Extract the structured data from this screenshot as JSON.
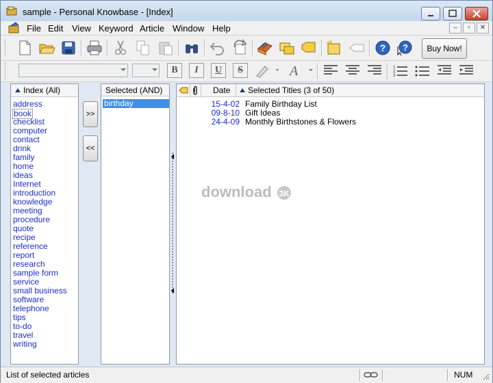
{
  "window": {
    "title": "sample - Personal Knowbase - [Index]"
  },
  "menu": {
    "items": [
      "File",
      "Edit",
      "View",
      "Keyword",
      "Article",
      "Window",
      "Help"
    ]
  },
  "toolbar": {
    "icons": [
      "new-icon",
      "open-icon",
      "save-icon",
      "print-icon",
      "cut-icon",
      "copy-icon",
      "paste-icon",
      "find-icon",
      "undo-icon",
      "redo-icon",
      "keywords-icon",
      "windows-icon",
      "label-icon",
      "new-article-icon",
      "tag-icon",
      "help-icon",
      "whats-this-icon"
    ],
    "buy_now": "Buy Now!"
  },
  "index_panel": {
    "header": "Index (All)",
    "items": [
      "address",
      "book",
      "checklist",
      "computer",
      "contact",
      "drink",
      "family",
      "home",
      "ideas",
      "Internet",
      "introduction",
      "knowledge",
      "meeting",
      "procedure",
      "quote",
      "recipe",
      "reference",
      "report",
      "research",
      "sample form",
      "service",
      "small business",
      "software",
      "telephone",
      "tips",
      "to-do",
      "travel",
      "writing"
    ]
  },
  "buttons": {
    "add": ">>",
    "remove": "<<"
  },
  "selected_panel": {
    "header": "Selected (AND)",
    "items": [
      "birthday"
    ]
  },
  "titles_panel": {
    "date_header": "Date",
    "titles_header": "Selected Titles (3 of 50)",
    "rows": [
      {
        "date": "15-4-02",
        "title": "Family Birthday List"
      },
      {
        "date": "09-8-10",
        "title": "Gift Ideas"
      },
      {
        "date": "24-4-09",
        "title": "Monthly Birthstones & Flowers"
      }
    ]
  },
  "watermark": "download",
  "status": {
    "text": "List of selected articles",
    "num": "NUM"
  },
  "colors": {
    "link_blue": "#1a2ccc",
    "selection_blue": "#3f8fe6"
  }
}
